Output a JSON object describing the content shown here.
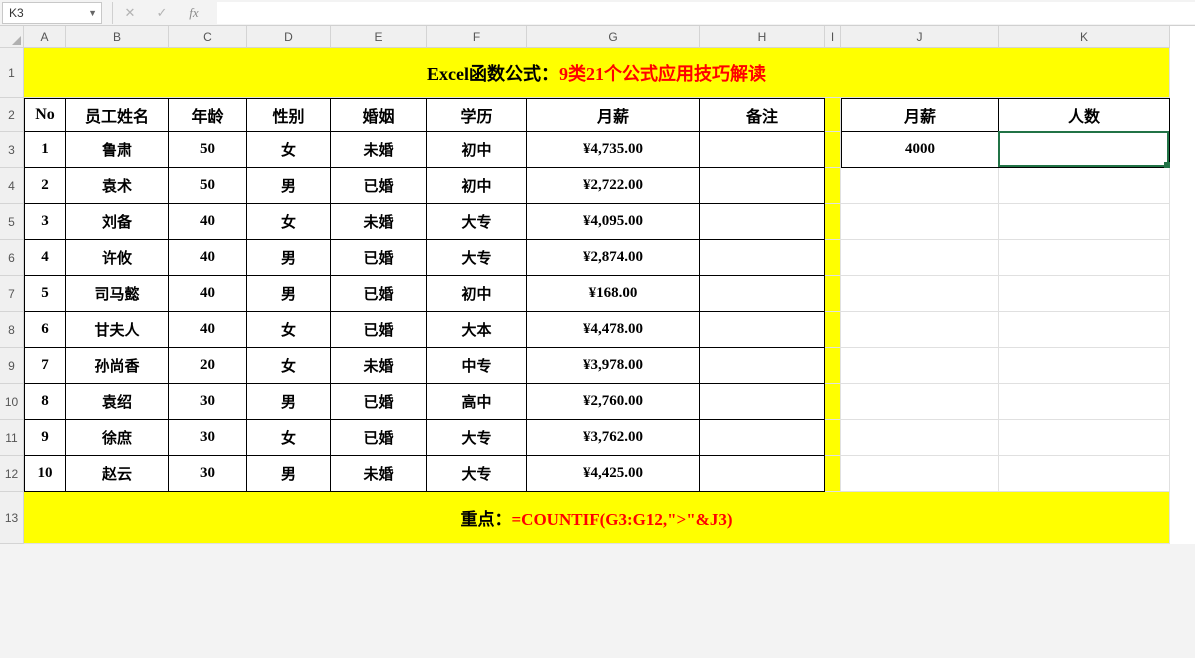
{
  "nameBox": {
    "value": "K3"
  },
  "formulaBar": {
    "value": ""
  },
  "columns": [
    {
      "letter": "A",
      "width": 42
    },
    {
      "letter": "B",
      "width": 103
    },
    {
      "letter": "C",
      "width": 78
    },
    {
      "letter": "D",
      "width": 84
    },
    {
      "letter": "E",
      "width": 96
    },
    {
      "letter": "F",
      "width": 100
    },
    {
      "letter": "G",
      "width": 173
    },
    {
      "letter": "H",
      "width": 125
    },
    {
      "letter": "I",
      "width": 16
    },
    {
      "letter": "J",
      "width": 158
    },
    {
      "letter": "K",
      "width": 171
    }
  ],
  "title": {
    "part1": "Excel函数公式：",
    "part2": "9类21个公式应用技巧解读"
  },
  "headers": {
    "a": "No",
    "b": "员工姓名",
    "c": "年龄",
    "d": "性别",
    "e": "婚姻",
    "f": "学历",
    "g": "月薪",
    "h": "备注",
    "j": "月薪",
    "k": "人数"
  },
  "rows": [
    {
      "no": "1",
      "name": "鲁肃",
      "age": "50",
      "gender": "女",
      "marital": "未婚",
      "edu": "初中",
      "salary": "¥4,735.00"
    },
    {
      "no": "2",
      "name": "袁术",
      "age": "50",
      "gender": "男",
      "marital": "已婚",
      "edu": "初中",
      "salary": "¥2,722.00"
    },
    {
      "no": "3",
      "name": "刘备",
      "age": "40",
      "gender": "女",
      "marital": "未婚",
      "edu": "大专",
      "salary": "¥4,095.00"
    },
    {
      "no": "4",
      "name": "许攸",
      "age": "40",
      "gender": "男",
      "marital": "已婚",
      "edu": "大专",
      "salary": "¥2,874.00"
    },
    {
      "no": "5",
      "name": "司马懿",
      "age": "40",
      "gender": "男",
      "marital": "已婚",
      "edu": "初中",
      "salary": "¥168.00"
    },
    {
      "no": "6",
      "name": "甘夫人",
      "age": "40",
      "gender": "女",
      "marital": "已婚",
      "edu": "大本",
      "salary": "¥4,478.00"
    },
    {
      "no": "7",
      "name": "孙尚香",
      "age": "20",
      "gender": "女",
      "marital": "未婚",
      "edu": "中专",
      "salary": "¥3,978.00"
    },
    {
      "no": "8",
      "name": "袁绍",
      "age": "30",
      "gender": "男",
      "marital": "已婚",
      "edu": "高中",
      "salary": "¥2,760.00"
    },
    {
      "no": "9",
      "name": "徐庶",
      "age": "30",
      "gender": "女",
      "marital": "已婚",
      "edu": "大专",
      "salary": "¥3,762.00"
    },
    {
      "no": "10",
      "name": "赵云",
      "age": "30",
      "gender": "男",
      "marital": "未婚",
      "edu": "大专",
      "salary": "¥4,425.00"
    }
  ],
  "side": {
    "j3": "4000",
    "k3": ""
  },
  "footer": {
    "part1": "重点：",
    "part2": "=COUNTIF(G3:G12,\">\"&J3)"
  },
  "rowLabels": [
    "1",
    "2",
    "3",
    "4",
    "5",
    "6",
    "7",
    "8",
    "9",
    "10",
    "11",
    "12",
    "13"
  ]
}
